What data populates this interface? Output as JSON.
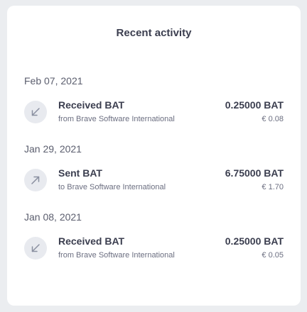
{
  "title": "Recent activity",
  "groups": [
    {
      "date": "Feb 07, 2021",
      "tx": {
        "icon": "arrow-down-left-icon",
        "title": "Received BAT",
        "subtitle": "from Brave Software International",
        "amount": "0.25000 BAT",
        "fiat": "€ 0.08"
      }
    },
    {
      "date": "Jan 29, 2021",
      "tx": {
        "icon": "arrow-up-right-icon",
        "title": "Sent BAT",
        "subtitle": "to Brave Software International",
        "amount": "6.75000 BAT",
        "fiat": "€ 1.70"
      }
    },
    {
      "date": "Jan 08, 2021",
      "tx": {
        "icon": "arrow-down-left-icon",
        "title": "Received BAT",
        "subtitle": "from Brave Software International",
        "amount": "0.25000 BAT",
        "fiat": "€ 0.05"
      }
    }
  ],
  "colors": {
    "background": "#ebedf0",
    "card": "#ffffff",
    "icon_circle": "#e8eaef",
    "icon_stroke": "#8a8fa0"
  }
}
